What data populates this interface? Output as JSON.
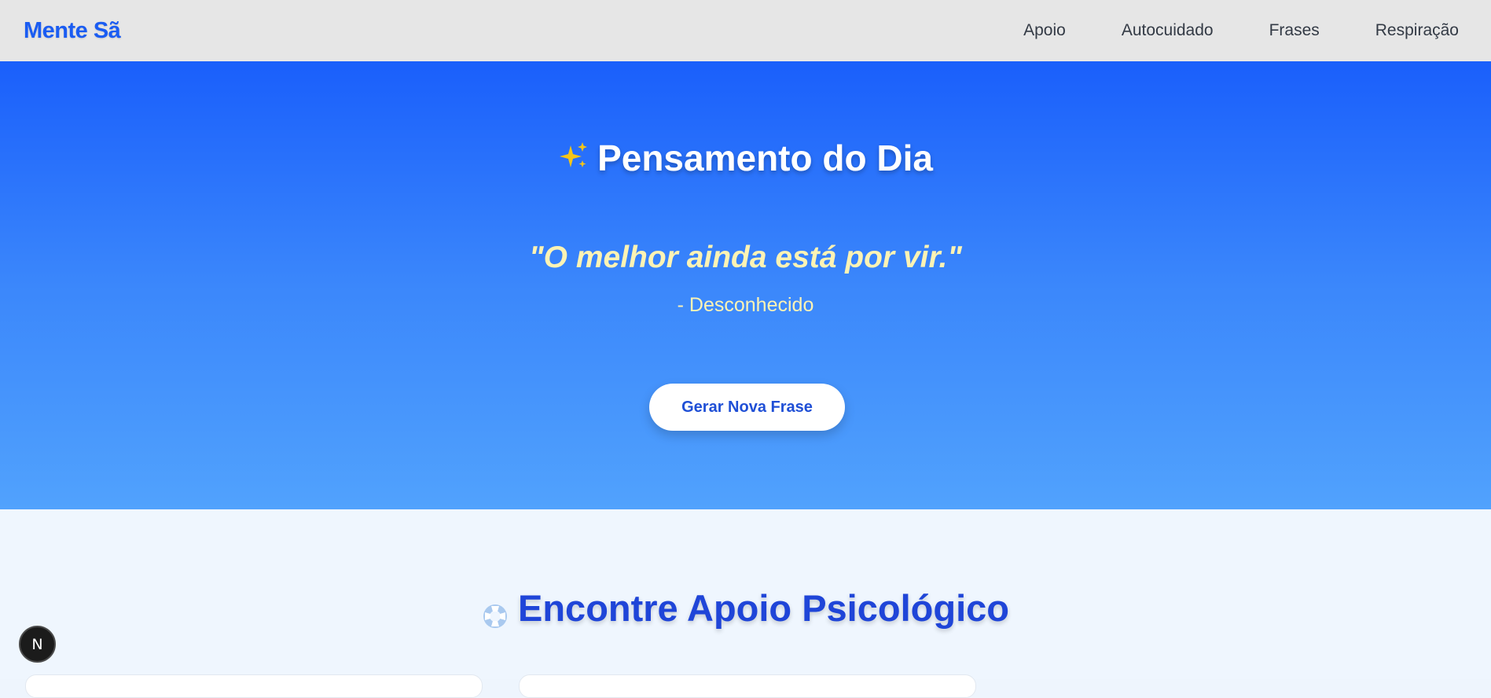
{
  "navbar": {
    "brand": "Mente Sã",
    "links": [
      {
        "label": "Apoio"
      },
      {
        "label": "Autocuidado"
      },
      {
        "label": "Frases"
      },
      {
        "label": "Respiração"
      }
    ]
  },
  "hero": {
    "icon": "sparkles-icon",
    "title": "Pensamento do Dia",
    "quote": "\"O melhor ainda está por vir.\"",
    "author": "- Desconhecido",
    "button_label": "Gerar Nova Frase"
  },
  "support": {
    "icon": "lifebuoy-icon",
    "title": "Encontre Apoio Psicológico"
  },
  "dev_badge": {
    "label": "N"
  },
  "colors": {
    "brand": "#1a5cf2",
    "hero_gradient_top": "#1a5ffb",
    "hero_gradient_bottom": "#51a2fd",
    "quote": "#fdf3b4",
    "support_title": "#1f45d8",
    "sparkle": "#f5c518"
  }
}
